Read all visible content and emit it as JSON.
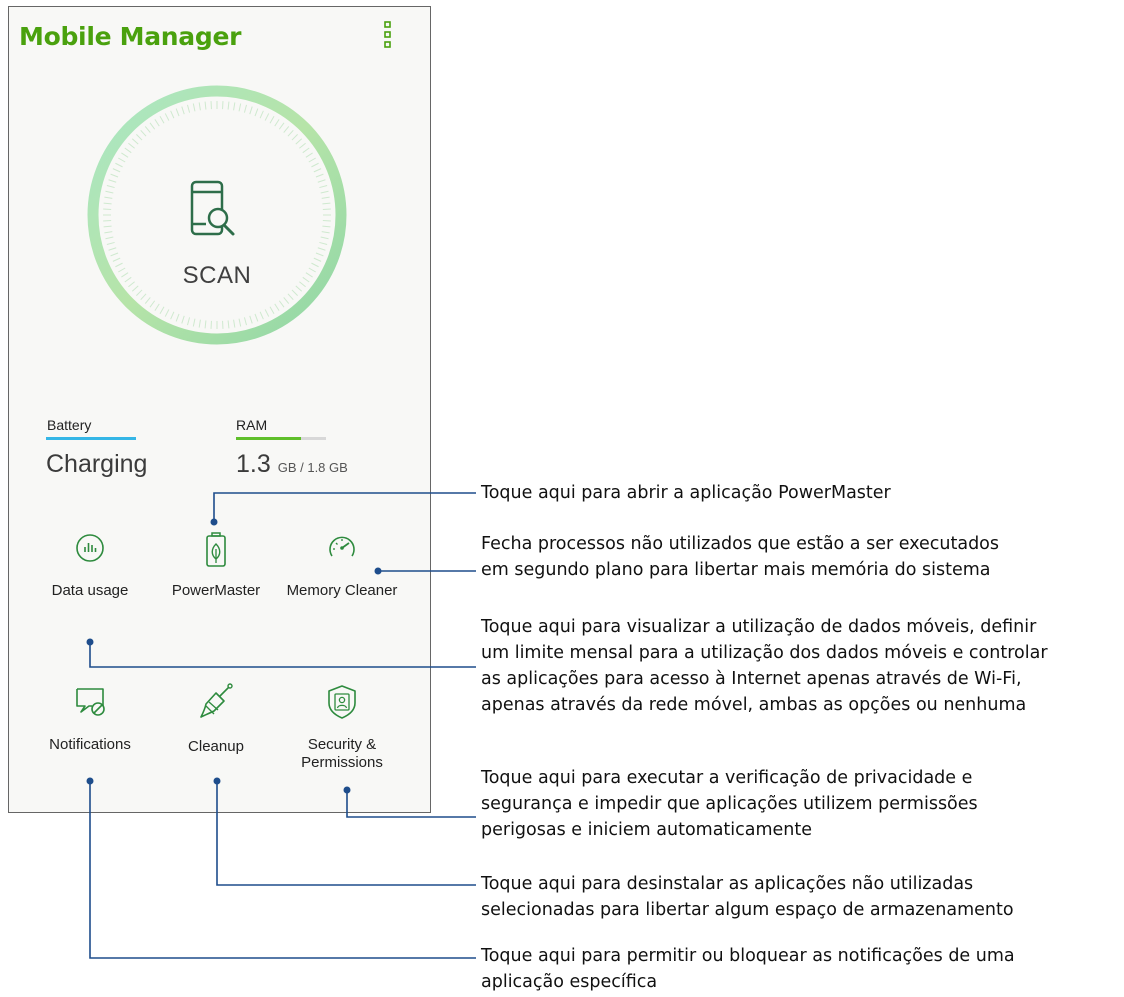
{
  "app": {
    "title": "Mobile Manager"
  },
  "scan": {
    "label": "SCAN"
  },
  "stats": {
    "battery": {
      "label": "Battery",
      "value": "Charging",
      "bar_color": "#35b6e6"
    },
    "ram": {
      "label": "RAM",
      "used": "1.3",
      "detail": "GB / 1.8 GB",
      "fill_fraction": 0.72,
      "bar_color": "#5fbf2a"
    }
  },
  "tiles": [
    {
      "label": "Data usage",
      "icon": "bar-chart-icon"
    },
    {
      "label": "PowerMaster",
      "icon": "battery-leaf-icon"
    },
    {
      "label": "Memory Cleaner",
      "icon": "speedometer-icon"
    },
    {
      "label": "Notifications",
      "icon": "notification-block-icon"
    },
    {
      "label": "Cleanup",
      "icon": "broom-icon"
    },
    {
      "label": "Security &\nPermissions",
      "icon": "shield-user-icon"
    }
  ],
  "callouts": [
    {
      "target": "PowerMaster",
      "text": "Toque aqui para abrir a aplicação PowerMaster"
    },
    {
      "target": "Memory Cleaner",
      "text": "Fecha processos não utilizados que estão a ser executados\nem segundo plano para libertar mais memória do sistema"
    },
    {
      "target": "Data usage",
      "text": "Toque aqui para visualizar a utilização de dados móveis, definir\num limite mensal para a utilização dos dados móveis e controlar\nas aplicações para acesso à Internet apenas através de Wi-Fi,\napenas através da rede móvel, ambas as opções ou nenhuma"
    },
    {
      "target": "Security & Permissions",
      "text": "Toque aqui para executar a verificação de privacidade e\nsegurança e impedir que aplicações utilizem permissões\nperigosas e iniciem automaticamente"
    },
    {
      "target": "Cleanup",
      "text": "Toque aqui para desinstalar as aplicações não utilizadas\nselecionadas para libertar algum espaço de armazenamento"
    },
    {
      "target": "Notifications",
      "text": "Toque aqui para permitir ou bloquear as notificações de uma\naplicação específica"
    }
  ],
  "colors": {
    "accent_green": "#4aa10e",
    "icon_green": "#2e8b3e",
    "callout_line": "#1e4d8c"
  }
}
